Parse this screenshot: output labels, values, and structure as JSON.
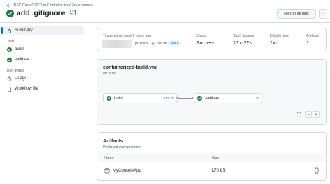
{
  "header": {
    "back_label": ".NET Core CI/CD in Containerized Environment",
    "title": "add .gitignore",
    "run_number": "#1",
    "rerun_label": "Re-run all jobs",
    "more_label": "···"
  },
  "sidebar": {
    "summary": "Summary",
    "jobs_heading": "Jobs",
    "jobs": [
      "build",
      "validate"
    ],
    "run_details_heading": "Run details",
    "details": [
      "Usage",
      "Workflow file"
    ]
  },
  "summary": {
    "trigger": "Triggered via push 6 hours ago",
    "pushed": "pushed",
    "commit": "c462f03",
    "branch": "main",
    "status_label": "Status",
    "status_value": "Success",
    "duration_label": "Total duration",
    "duration_value": "22m 35s",
    "billable_label": "Billable time",
    "billable_value": "1m",
    "artifacts_label": "Artifacts",
    "artifacts_value": "1"
  },
  "workflow": {
    "name": "containerized-build.yml",
    "event": "on: push",
    "jobs": [
      {
        "name": "build",
        "duration": "20m 3s"
      },
      {
        "name": "validate",
        "duration": "7s"
      }
    ],
    "zoom_out": "−",
    "zoom_in": "+"
  },
  "artifacts": {
    "title": "Artifacts",
    "subtitle": "Produced during runtime",
    "col_name": "Name",
    "col_size": "Size",
    "items": [
      {
        "name": "MyConsoleApp",
        "size": "170 KB"
      }
    ]
  },
  "colors": {
    "success": "#1a7f37",
    "accent": "#0969da",
    "border": "#d1d9e0",
    "muted": "#59636e"
  },
  "icons": [
    "arrow-left-icon",
    "check-circle-icon",
    "home-icon",
    "stopwatch-icon",
    "file-icon",
    "commit-icon",
    "fullscreen-icon",
    "package-icon",
    "trash-icon"
  ]
}
